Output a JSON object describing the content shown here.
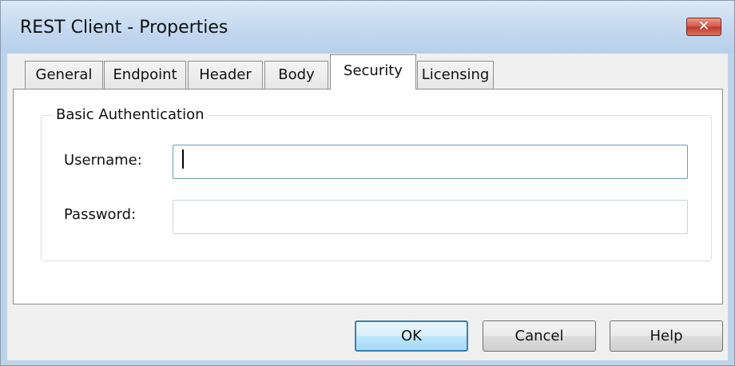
{
  "window": {
    "title": "REST Client - Properties",
    "close_glyph": "✕"
  },
  "tabs": [
    {
      "label": "General"
    },
    {
      "label": "Endpoint"
    },
    {
      "label": "Header"
    },
    {
      "label": "Body"
    },
    {
      "label": "Security"
    },
    {
      "label": "Licensing"
    }
  ],
  "active_tab": "Security",
  "security": {
    "group_label": "Basic Authentication",
    "username_label": "Username:",
    "username_value": "",
    "password_label": "Password:",
    "password_value": ""
  },
  "buttons": {
    "ok": "OK",
    "cancel": "Cancel",
    "help": "Help"
  },
  "colors": {
    "title_bar": "#c4d8ef",
    "close_button": "#c0392b",
    "default_button_border": "#3c7fb1"
  }
}
